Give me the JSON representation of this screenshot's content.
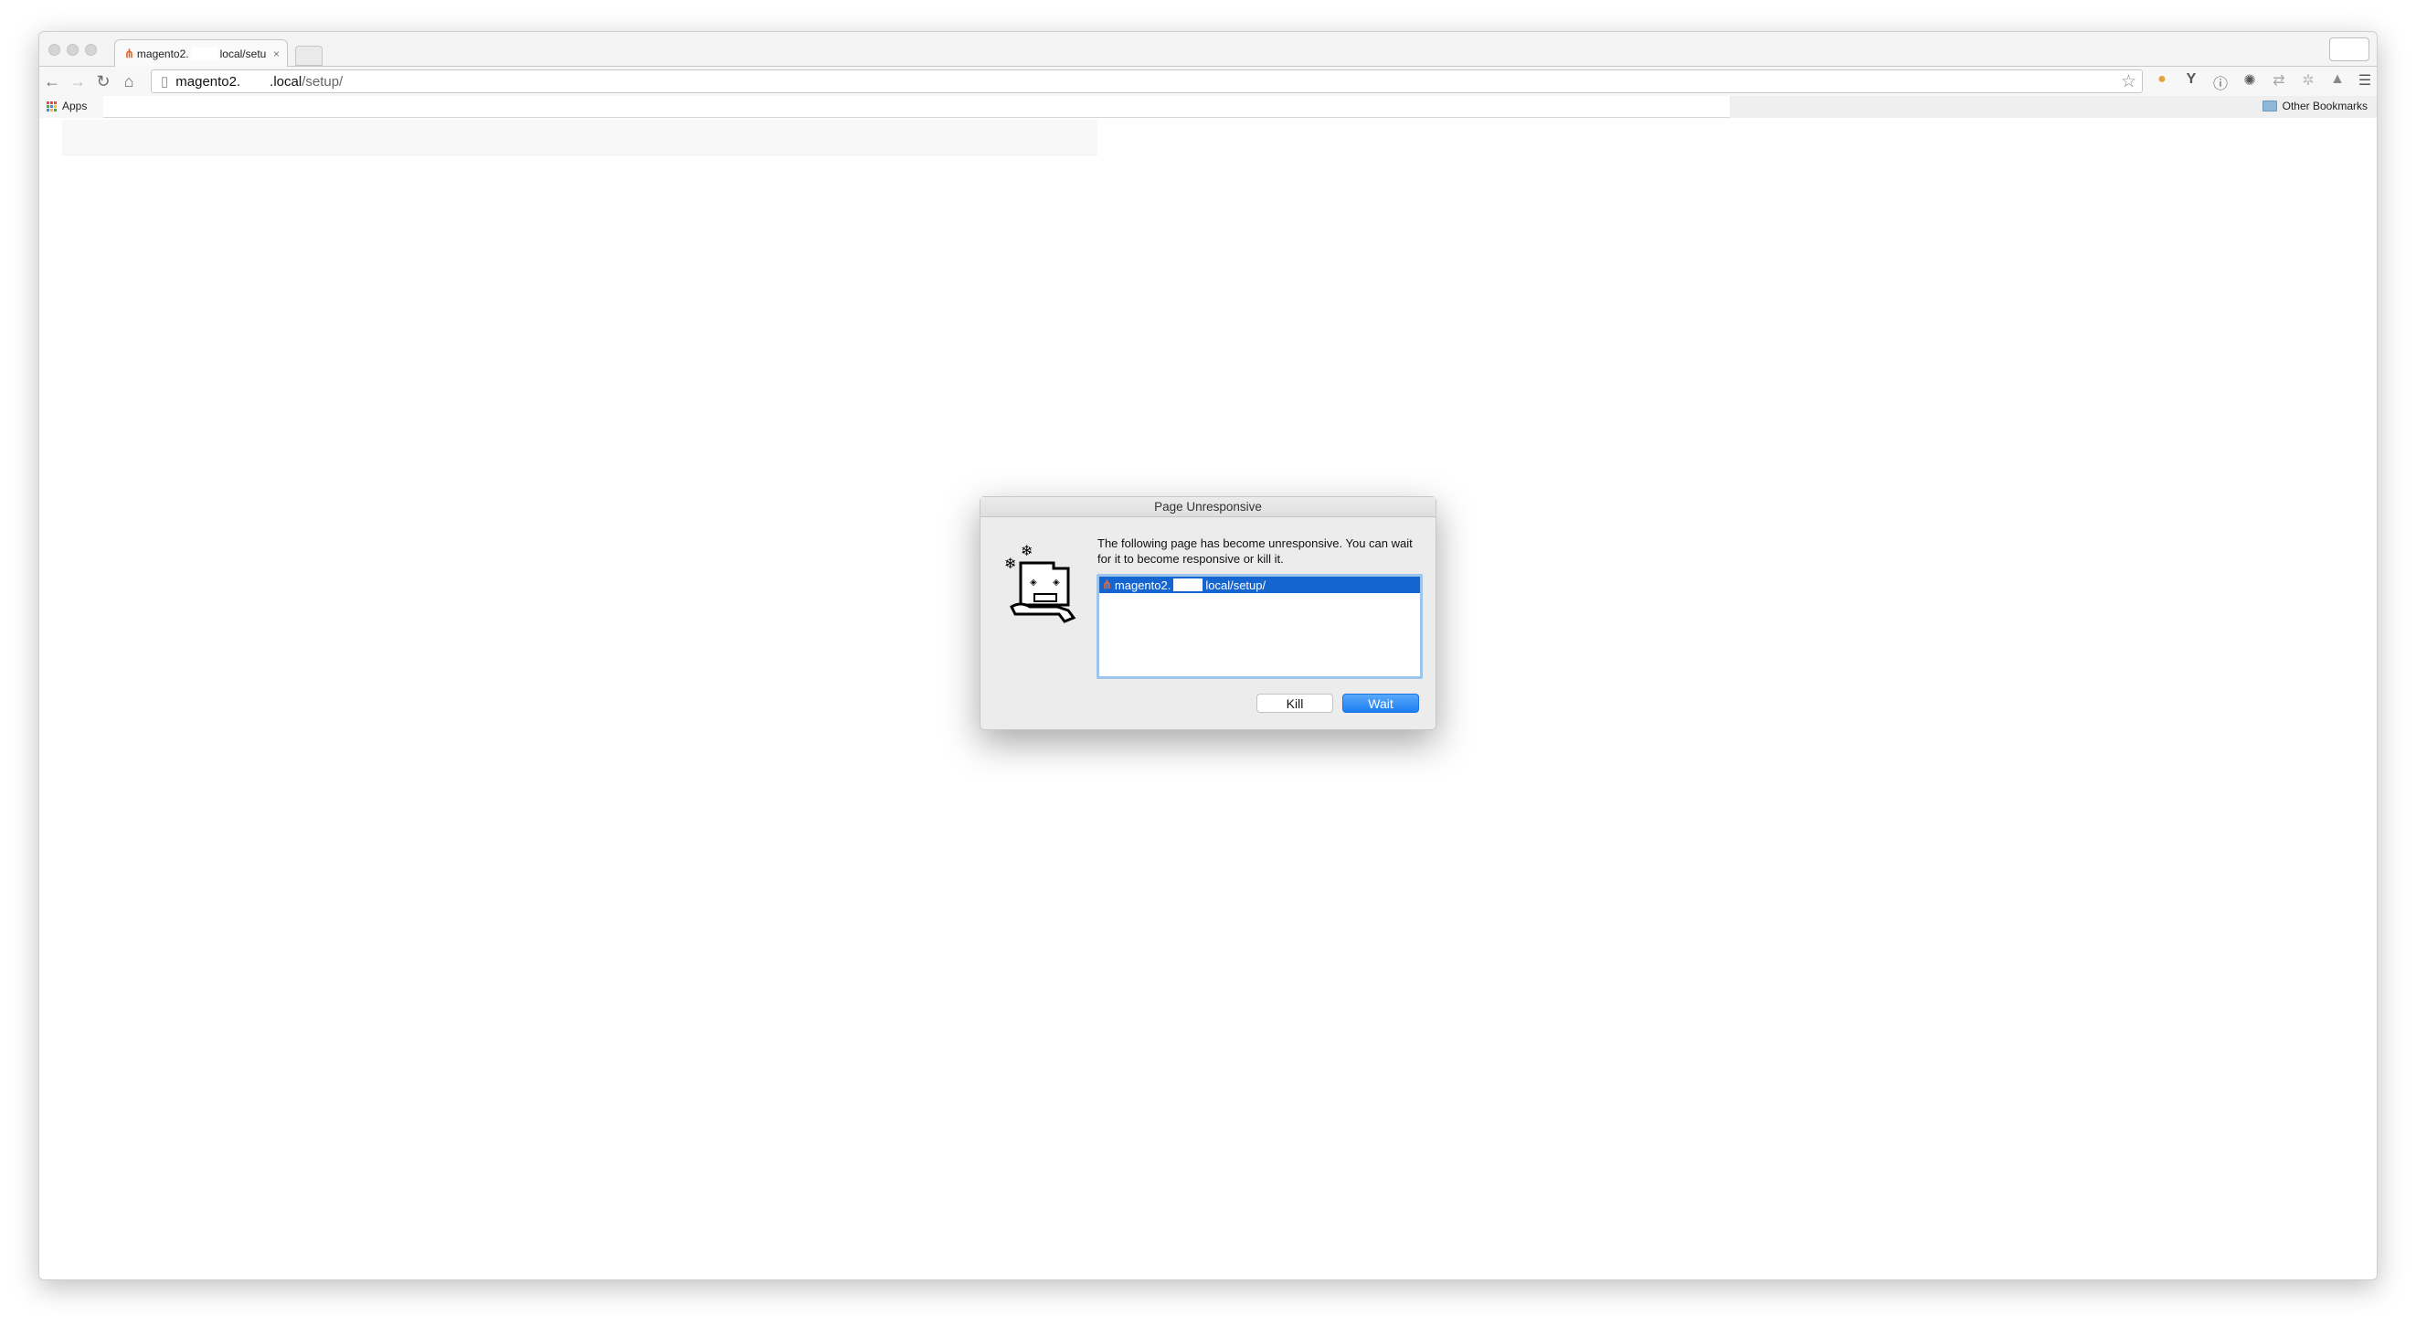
{
  "browser": {
    "tab": {
      "title_prefix": "magento2.",
      "title_suffix": "local/setu",
      "close": "×"
    },
    "address": {
      "host_prefix": "magento2.",
      "host_suffix": ".local",
      "path": "/setup/"
    },
    "bookmarks": {
      "apps": "Apps",
      "other": "Other Bookmarks"
    },
    "extensions": [
      "cookie-icon",
      "y-icon",
      "1password-icon",
      "gear-icon",
      "sync-icon",
      "bug-icon",
      "drive-icon",
      "menu-icon"
    ]
  },
  "dialog": {
    "title": "Page Unresponsive",
    "message": "The following page has become unresponsive. You can wait for it to become responsive or kill it.",
    "list_item_prefix": "magento2.",
    "list_item_suffix": "local/setup/",
    "kill_label": "Kill",
    "wait_label": "Wait",
    "accent": "#1c7ef2"
  }
}
